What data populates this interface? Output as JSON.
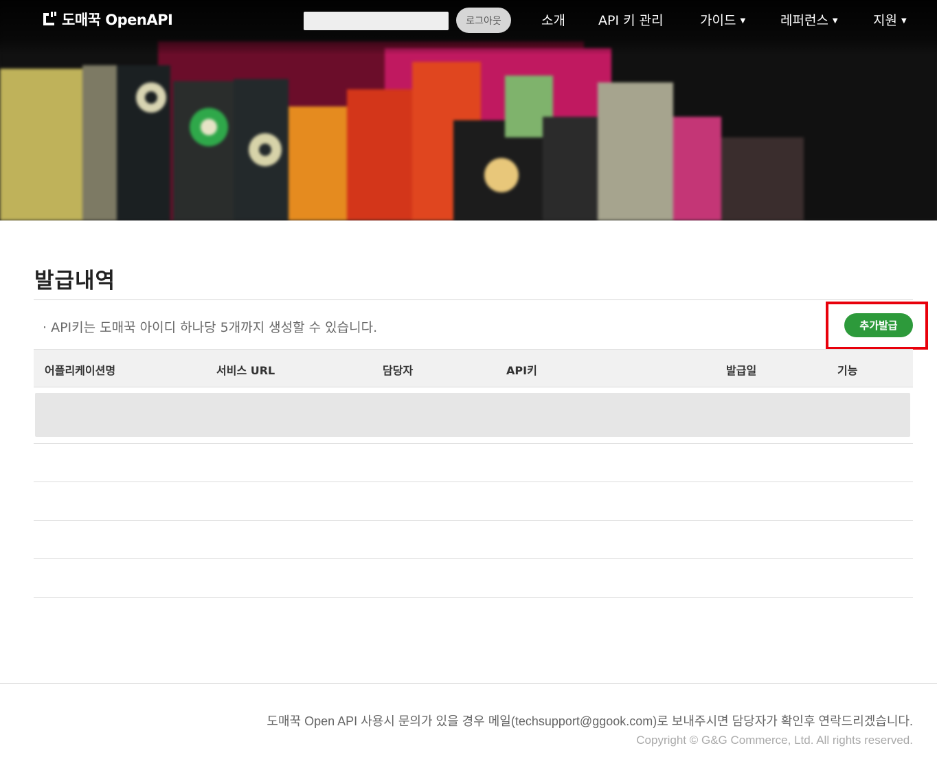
{
  "header": {
    "logo_text": "도매꾹 OpenAPI",
    "search_placeholder": "",
    "logout_label": "로그아웃",
    "nav": [
      {
        "label": "소개"
      },
      {
        "label": "API 키 관리"
      },
      {
        "label": "가이드"
      },
      {
        "label": "레퍼런스"
      },
      {
        "label": "지원"
      }
    ],
    "caret": "▼"
  },
  "main": {
    "title": "발급내역",
    "notice": "· API키는 도매꾹 아이디 하나당 5개까지 생성할 수 있습니다.",
    "add_button_label": "추가발급",
    "highlight_color": "#e8000b",
    "accent_color": "#2d9a3b",
    "table": {
      "columns": [
        "어플리케이션명",
        "서비스 URL",
        "담당자",
        "API키",
        "발급일",
        "기능"
      ]
    }
  },
  "footer": {
    "contact": "도매꾹 Open API 사용시 문의가 있을 경우 메일(techsupport@ggook.com)로 보내주시면 담당자가 확인후 연락드리겠습니다.",
    "copyright": "Copyright © G&G Commerce, Ltd. All rights reserved."
  }
}
